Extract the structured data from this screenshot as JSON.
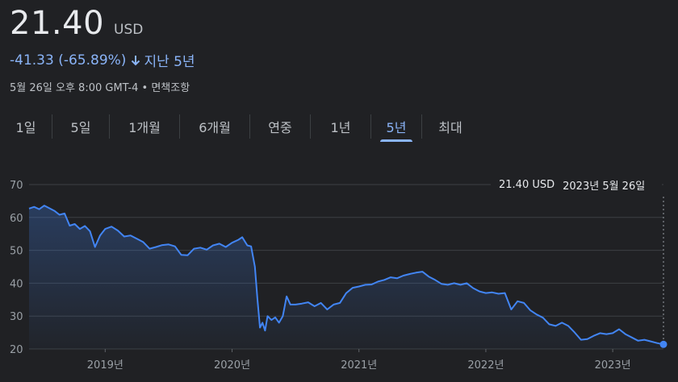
{
  "header": {
    "price": "21.40",
    "currency": "USD",
    "change": "-41.33 (-65.89%)",
    "change_period": "지난 5년",
    "timestamp": "5월 26일 오후 8:00 GMT-4",
    "separator": "•",
    "disclaimer": "면책조항",
    "change_color": "#8ab4f8"
  },
  "tabs": [
    {
      "label": "1일",
      "active": false
    },
    {
      "label": "5일",
      "active": false
    },
    {
      "label": "1개월",
      "active": false
    },
    {
      "label": "6개월",
      "active": false
    },
    {
      "label": "연중",
      "active": false
    },
    {
      "label": "1년",
      "active": false
    },
    {
      "label": "5년",
      "active": true
    },
    {
      "label": "최대",
      "active": false
    }
  ],
  "tooltip": {
    "value": "21.40 USD",
    "date": "2023년 5월 26일"
  },
  "chart_data": {
    "type": "area",
    "line_color": "#4285f4",
    "grid": true,
    "ylim": [
      20,
      70
    ],
    "yticks": [
      20,
      30,
      40,
      50,
      60,
      70
    ],
    "xlim": [
      2018.4,
      2023.4
    ],
    "xticks": [
      {
        "value": 2019.0,
        "label": "2019년"
      },
      {
        "value": 2020.0,
        "label": "2020년"
      },
      {
        "value": 2021.0,
        "label": "2021년"
      },
      {
        "value": 2022.0,
        "label": "2022년"
      },
      {
        "value": 2023.0,
        "label": "2023년"
      }
    ],
    "series": [
      {
        "points": [
          [
            2018.4,
            62.7
          ],
          [
            2018.44,
            63.2
          ],
          [
            2018.48,
            62.5
          ],
          [
            2018.52,
            63.6
          ],
          [
            2018.56,
            62.8
          ],
          [
            2018.6,
            62.0
          ],
          [
            2018.64,
            60.8
          ],
          [
            2018.68,
            61.2
          ],
          [
            2018.72,
            57.5
          ],
          [
            2018.76,
            58.0
          ],
          [
            2018.8,
            56.5
          ],
          [
            2018.84,
            57.4
          ],
          [
            2018.88,
            55.8
          ],
          [
            2018.92,
            51.0
          ],
          [
            2018.96,
            54.5
          ],
          [
            2019.0,
            56.5
          ],
          [
            2019.05,
            57.2
          ],
          [
            2019.1,
            56.0
          ],
          [
            2019.15,
            54.2
          ],
          [
            2019.2,
            54.5
          ],
          [
            2019.25,
            53.5
          ],
          [
            2019.3,
            52.5
          ],
          [
            2019.35,
            50.5
          ],
          [
            2019.4,
            51.0
          ],
          [
            2019.45,
            51.6
          ],
          [
            2019.5,
            51.8
          ],
          [
            2019.55,
            51.2
          ],
          [
            2019.6,
            48.6
          ],
          [
            2019.65,
            48.5
          ],
          [
            2019.7,
            50.5
          ],
          [
            2019.75,
            50.8
          ],
          [
            2019.8,
            50.2
          ],
          [
            2019.85,
            51.5
          ],
          [
            2019.9,
            52.0
          ],
          [
            2019.95,
            51.0
          ],
          [
            2020.0,
            52.3
          ],
          [
            2020.05,
            53.2
          ],
          [
            2020.08,
            54.0
          ],
          [
            2020.12,
            51.5
          ],
          [
            2020.15,
            51.2
          ],
          [
            2020.18,
            45.0
          ],
          [
            2020.2,
            35.0
          ],
          [
            2020.22,
            26.5
          ],
          [
            2020.24,
            28.0
          ],
          [
            2020.26,
            25.6
          ],
          [
            2020.28,
            30.0
          ],
          [
            2020.31,
            28.8
          ],
          [
            2020.34,
            29.6
          ],
          [
            2020.37,
            28.0
          ],
          [
            2020.4,
            30.0
          ],
          [
            2020.43,
            36.0
          ],
          [
            2020.46,
            33.5
          ],
          [
            2020.5,
            33.5
          ],
          [
            2020.55,
            33.8
          ],
          [
            2020.6,
            34.2
          ],
          [
            2020.65,
            33.0
          ],
          [
            2020.7,
            34.0
          ],
          [
            2020.75,
            32.0
          ],
          [
            2020.8,
            33.5
          ],
          [
            2020.85,
            34.0
          ],
          [
            2020.9,
            37.0
          ],
          [
            2020.95,
            38.6
          ],
          [
            2021.0,
            39.0
          ],
          [
            2021.05,
            39.5
          ],
          [
            2021.1,
            39.6
          ],
          [
            2021.15,
            40.5
          ],
          [
            2021.2,
            41.0
          ],
          [
            2021.25,
            41.8
          ],
          [
            2021.3,
            41.5
          ],
          [
            2021.35,
            42.3
          ],
          [
            2021.4,
            42.8
          ],
          [
            2021.45,
            43.2
          ],
          [
            2021.5,
            43.5
          ],
          [
            2021.55,
            42.0
          ],
          [
            2021.6,
            41.0
          ],
          [
            2021.65,
            39.8
          ],
          [
            2021.7,
            39.5
          ],
          [
            2021.75,
            40.0
          ],
          [
            2021.8,
            39.5
          ],
          [
            2021.85,
            40.0
          ],
          [
            2021.9,
            38.5
          ],
          [
            2021.95,
            37.5
          ],
          [
            2022.0,
            37.0
          ],
          [
            2022.05,
            37.2
          ],
          [
            2022.1,
            36.8
          ],
          [
            2022.15,
            37.0
          ],
          [
            2022.2,
            32.0
          ],
          [
            2022.25,
            34.5
          ],
          [
            2022.3,
            34.0
          ],
          [
            2022.35,
            31.8
          ],
          [
            2022.4,
            30.5
          ],
          [
            2022.45,
            29.5
          ],
          [
            2022.5,
            27.5
          ],
          [
            2022.55,
            27.0
          ],
          [
            2022.6,
            28.0
          ],
          [
            2022.65,
            27.0
          ],
          [
            2022.7,
            25.0
          ],
          [
            2022.75,
            22.8
          ],
          [
            2022.8,
            23.0
          ],
          [
            2022.85,
            24.0
          ],
          [
            2022.9,
            24.8
          ],
          [
            2022.95,
            24.5
          ],
          [
            2023.0,
            24.8
          ],
          [
            2023.05,
            26.0
          ],
          [
            2023.1,
            24.5
          ],
          [
            2023.15,
            23.5
          ],
          [
            2023.2,
            22.5
          ],
          [
            2023.25,
            22.8
          ],
          [
            2023.3,
            22.3
          ],
          [
            2023.35,
            21.8
          ],
          [
            2023.4,
            21.4
          ]
        ]
      }
    ]
  }
}
